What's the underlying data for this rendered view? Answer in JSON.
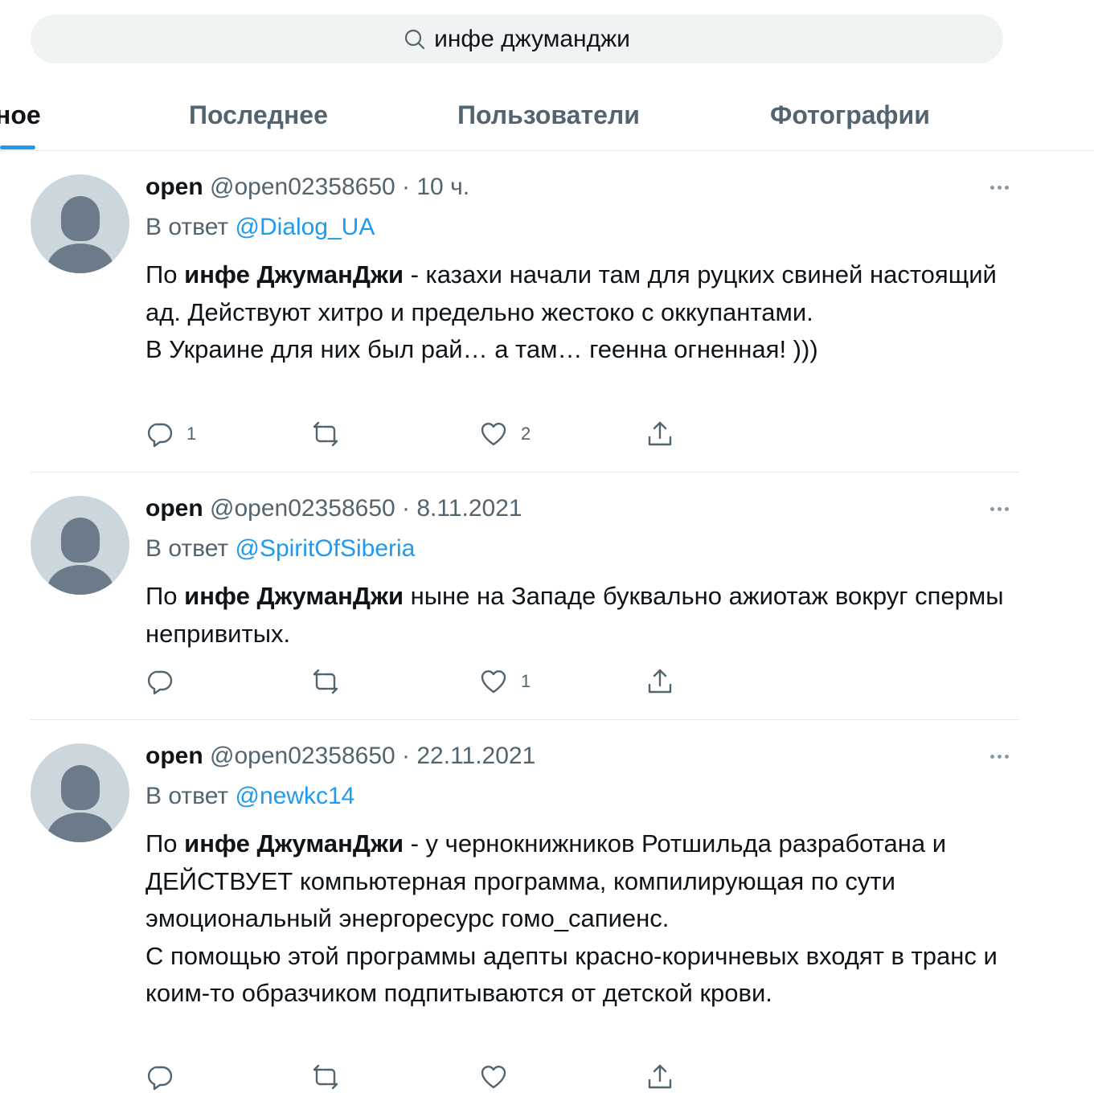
{
  "search": {
    "query": "инфе джуманджи"
  },
  "tabs": [
    {
      "label": "ное"
    },
    {
      "label": "Последнее"
    },
    {
      "label": "Пользователи"
    },
    {
      "label": "Фотографии"
    }
  ],
  "tweets": [
    {
      "name": "open",
      "handle": "@open02358650",
      "separator": "·",
      "time": "10 ч.",
      "reply_prefix": "В ответ",
      "reply_to": "@Dialog_UA",
      "lead": "По ",
      "highlight": "инфе ДжуманДжи",
      "rest": " - казахи начали там для руцких свиней настоящий ад. Действуют хитро и предельно жестоко с оккупантами.",
      "extra": "В Украине для них был рай… а там… геенна огненная! )))",
      "reply_count": "1",
      "like_count": "2"
    },
    {
      "name": "open",
      "handle": "@open02358650",
      "separator": "·",
      "time": "8.11.2021",
      "reply_prefix": "В ответ",
      "reply_to": "@SpiritOfSiberia",
      "lead": "По ",
      "highlight": "инфе ДжуманДжи",
      "rest": " ныне на Западе буквально ажиотаж вокруг спермы непривитых.",
      "extra": "",
      "reply_count": "",
      "like_count": "1"
    },
    {
      "name": "open",
      "handle": "@open02358650",
      "separator": "·",
      "time": "22.11.2021",
      "reply_prefix": "В ответ",
      "reply_to": "@newkc14",
      "lead": "По ",
      "highlight": "инфе ДжуманДжи",
      "rest": " - у чернокнижников Ротшильда разработана и ДЕЙСТВУЕТ компьютерная программа, компилирующая по сути эмоциональный энергоресурс гомо_сапиенс.",
      "extra": "С помощью этой программы адепты красно-коричневых входят в транс и коим-то образчиком подпитываются от детской крови.",
      "reply_count": "",
      "like_count": ""
    }
  ],
  "colors": {
    "accent": "#1d9bf0",
    "muted": "#536471",
    "text": "#0f1419",
    "search_bg": "#eff3f4"
  },
  "icons": [
    "search-icon",
    "more-icon",
    "reply-icon",
    "retweet-icon",
    "like-icon",
    "share-icon",
    "avatar-placeholder-icon"
  ]
}
